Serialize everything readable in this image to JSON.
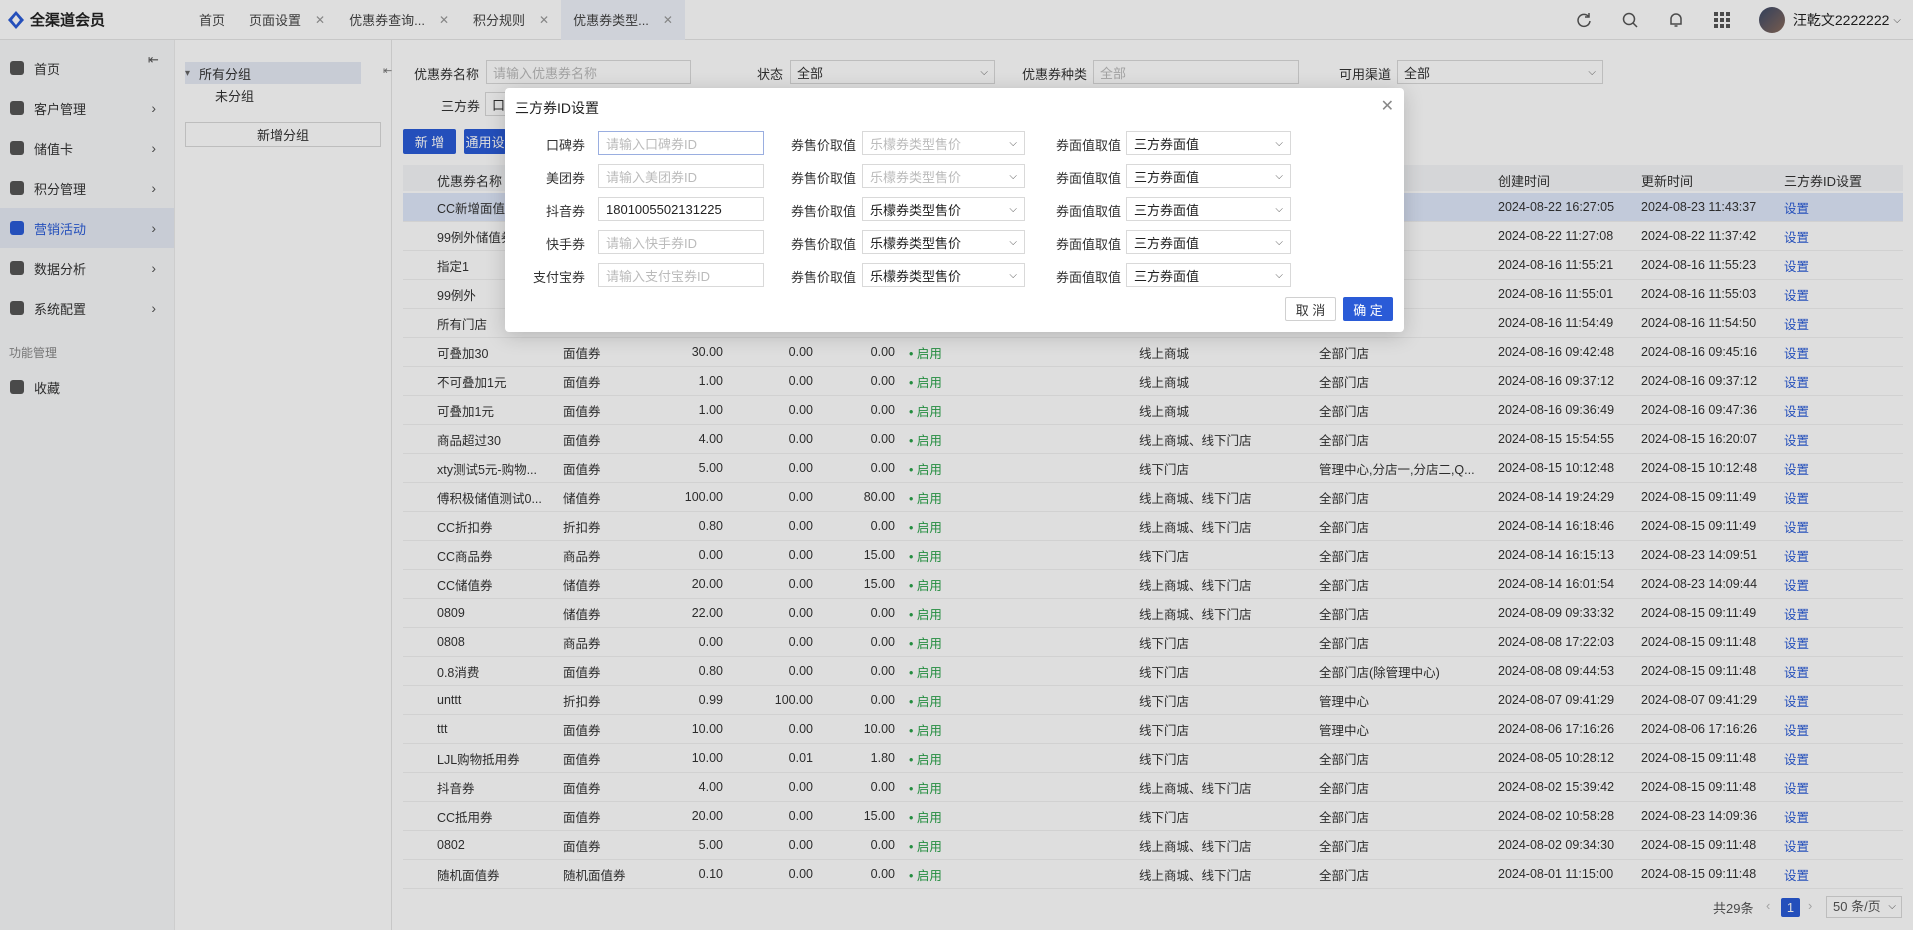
{
  "app": {
    "name": "全渠道会员",
    "username": "汪乾文2222222"
  },
  "tabs": [
    {
      "label": "首页",
      "closable": false
    },
    {
      "label": "页面设置",
      "closable": true
    },
    {
      "label": "优惠券查询...",
      "closable": true
    },
    {
      "label": "积分规则",
      "closable": true
    },
    {
      "label": "优惠券类型...",
      "closable": true,
      "active": true
    }
  ],
  "sidebar": {
    "items": [
      {
        "label": "首页",
        "icon": "home-icon"
      },
      {
        "label": "客户管理",
        "icon": "user-icon"
      },
      {
        "label": "储值卡",
        "icon": "card-icon"
      },
      {
        "label": "积分管理",
        "icon": "points-icon"
      },
      {
        "label": "营销活动",
        "icon": "marketing-icon",
        "active": true
      },
      {
        "label": "数据分析",
        "icon": "chart-icon"
      },
      {
        "label": "系统配置",
        "icon": "settings-icon"
      }
    ],
    "section_title": "功能管理",
    "favorites_label": "收藏"
  },
  "groups": {
    "root": "所有分组",
    "child": "未分组",
    "new_button": "新增分组"
  },
  "filters": {
    "name_label": "优惠券名称",
    "name_placeholder": "请输入优惠券名称",
    "status_label": "状态",
    "status_value": "全部",
    "type_label": "优惠券种类",
    "type_placeholder": "全部",
    "channel_label": "可用渠道",
    "channel_value": "全部",
    "third_label": "三方券",
    "third_value": "口",
    "add_button": "新 增",
    "general_button": "通用设"
  },
  "table": {
    "headers": {
      "name": "优惠券名称",
      "created": "创建时间",
      "updated": "更新时间",
      "third": "三方券ID设置"
    },
    "rows": [
      {
        "name": "CC新增面值",
        "type": "",
        "v1": "",
        "v2": "",
        "v3": "",
        "status": "",
        "channel": "",
        "store": "",
        "created": "2024-08-22 16:27:05",
        "updated": "2024-08-23 11:43:37",
        "action": "设置"
      },
      {
        "name": "99例外储值券",
        "type": "",
        "v1": "",
        "v2": "",
        "v3": "",
        "status": "",
        "channel": "",
        "store": "",
        "created": "2024-08-22 11:27:08",
        "updated": "2024-08-22 11:37:42",
        "action": "设置"
      },
      {
        "name": "指定1",
        "type": "",
        "v1": "",
        "v2": "",
        "v3": "",
        "status": "",
        "channel": "",
        "store": "",
        "created": "2024-08-16 11:55:21",
        "updated": "2024-08-16 11:55:23",
        "action": "设置"
      },
      {
        "name": "99例外",
        "type": "",
        "v1": "",
        "v2": "",
        "v3": "",
        "status": "",
        "channel": "",
        "store": "理中心)",
        "created": "2024-08-16 11:55:01",
        "updated": "2024-08-16 11:55:03",
        "action": "设置"
      },
      {
        "name": "所有门店",
        "type": "",
        "v1": "",
        "v2": "",
        "v3": "",
        "status": "",
        "channel": "",
        "store": "",
        "created": "2024-08-16 11:54:49",
        "updated": "2024-08-16 11:54:50",
        "action": "设置"
      },
      {
        "name": "可叠加30",
        "type": "面值券",
        "v1": "30.00",
        "v2": "0.00",
        "v3": "0.00",
        "status": "• 启用",
        "channel": "线上商城",
        "store": "全部门店",
        "created": "2024-08-16 09:42:48",
        "updated": "2024-08-16 09:45:16",
        "action": "设置"
      },
      {
        "name": "不可叠加1元",
        "type": "面值券",
        "v1": "1.00",
        "v2": "0.00",
        "v3": "0.00",
        "status": "• 启用",
        "channel": "线上商城",
        "store": "全部门店",
        "created": "2024-08-16 09:37:12",
        "updated": "2024-08-16 09:37:12",
        "action": "设置"
      },
      {
        "name": "可叠加1元",
        "type": "面值券",
        "v1": "1.00",
        "v2": "0.00",
        "v3": "0.00",
        "status": "• 启用",
        "channel": "线上商城",
        "store": "全部门店",
        "created": "2024-08-16 09:36:49",
        "updated": "2024-08-16 09:47:36",
        "action": "设置"
      },
      {
        "name": "商品超过30",
        "type": "面值券",
        "v1": "4.00",
        "v2": "0.00",
        "v3": "0.00",
        "status": "• 启用",
        "channel": "线上商城、线下门店",
        "store": "全部门店",
        "created": "2024-08-15 15:54:55",
        "updated": "2024-08-15 16:20:07",
        "action": "设置"
      },
      {
        "name": "xty测试5元-购物...",
        "type": "面值券",
        "v1": "5.00",
        "v2": "0.00",
        "v3": "0.00",
        "status": "• 启用",
        "channel": "线下门店",
        "store": "管理中心,分店一,分店二,Q...",
        "created": "2024-08-15 10:12:48",
        "updated": "2024-08-15 10:12:48",
        "action": "设置"
      },
      {
        "name": "傅积极储值测试0...",
        "type": "储值券",
        "v1": "100.00",
        "v2": "0.00",
        "v3": "80.00",
        "status": "• 启用",
        "channel": "线上商城、线下门店",
        "store": "全部门店",
        "created": "2024-08-14 19:24:29",
        "updated": "2024-08-15 09:11:49",
        "action": "设置"
      },
      {
        "name": "CC折扣券",
        "type": "折扣券",
        "v1": "0.80",
        "v2": "0.00",
        "v3": "0.00",
        "status": "• 启用",
        "channel": "线上商城、线下门店",
        "store": "全部门店",
        "created": "2024-08-14 16:18:46",
        "updated": "2024-08-15 09:11:49",
        "action": "设置"
      },
      {
        "name": "CC商品券",
        "type": "商品券",
        "v1": "0.00",
        "v2": "0.00",
        "v3": "15.00",
        "status": "• 启用",
        "channel": "线下门店",
        "store": "全部门店",
        "created": "2024-08-14 16:15:13",
        "updated": "2024-08-23 14:09:51",
        "action": "设置"
      },
      {
        "name": "CC储值券",
        "type": "储值券",
        "v1": "20.00",
        "v2": "0.00",
        "v3": "15.00",
        "status": "• 启用",
        "channel": "线上商城、线下门店",
        "store": "全部门店",
        "created": "2024-08-14 16:01:54",
        "updated": "2024-08-23 14:09:44",
        "action": "设置"
      },
      {
        "name": "0809",
        "type": "储值券",
        "v1": "22.00",
        "v2": "0.00",
        "v3": "0.00",
        "status": "• 启用",
        "channel": "线上商城、线下门店",
        "store": "全部门店",
        "created": "2024-08-09 09:33:32",
        "updated": "2024-08-15 09:11:49",
        "action": "设置"
      },
      {
        "name": "0808",
        "type": "商品券",
        "v1": "0.00",
        "v2": "0.00",
        "v3": "0.00",
        "status": "• 启用",
        "channel": "线下门店",
        "store": "全部门店",
        "created": "2024-08-08 17:22:03",
        "updated": "2024-08-15 09:11:48",
        "action": "设置"
      },
      {
        "name": "0.8消费",
        "type": "面值券",
        "v1": "0.80",
        "v2": "0.00",
        "v3": "0.00",
        "status": "• 启用",
        "channel": "线下门店",
        "store": "全部门店(除管理中心)",
        "created": "2024-08-08 09:44:53",
        "updated": "2024-08-15 09:11:48",
        "action": "设置"
      },
      {
        "name": "unttt",
        "type": "折扣券",
        "v1": "0.99",
        "v2": "100.00",
        "v3": "0.00",
        "status": "• 启用",
        "channel": "线下门店",
        "store": "管理中心",
        "created": "2024-08-07 09:41:29",
        "updated": "2024-08-07 09:41:29",
        "action": "设置"
      },
      {
        "name": "ttt",
        "type": "面值券",
        "v1": "10.00",
        "v2": "0.00",
        "v3": "10.00",
        "status": "• 启用",
        "channel": "线下门店",
        "store": "管理中心",
        "created": "2024-08-06 17:16:26",
        "updated": "2024-08-06 17:16:26",
        "action": "设置"
      },
      {
        "name": "LJL购物抵用券",
        "type": "面值券",
        "v1": "10.00",
        "v2": "0.01",
        "v3": "1.80",
        "status": "• 启用",
        "channel": "线下门店",
        "store": "全部门店",
        "created": "2024-08-05 10:28:12",
        "updated": "2024-08-15 09:11:48",
        "action": "设置"
      },
      {
        "name": "抖音券",
        "type": "面值券",
        "v1": "4.00",
        "v2": "0.00",
        "v3": "0.00",
        "status": "• 启用",
        "channel": "线上商城、线下门店",
        "store": "全部门店",
        "created": "2024-08-02 15:39:42",
        "updated": "2024-08-15 09:11:48",
        "action": "设置"
      },
      {
        "name": "CC抵用券",
        "type": "面值券",
        "v1": "20.00",
        "v2": "0.00",
        "v3": "15.00",
        "status": "• 启用",
        "channel": "线下门店",
        "store": "全部门店",
        "created": "2024-08-02 10:58:28",
        "updated": "2024-08-23 14:09:36",
        "action": "设置"
      },
      {
        "name": "0802",
        "type": "面值券",
        "v1": "5.00",
        "v2": "0.00",
        "v3": "0.00",
        "status": "• 启用",
        "channel": "线上商城、线下门店",
        "store": "全部门店",
        "created": "2024-08-02 09:34:30",
        "updated": "2024-08-15 09:11:48",
        "action": "设置"
      },
      {
        "name": "随机面值券",
        "type": "随机面值券",
        "v1": "0.10",
        "v2": "0.00",
        "v3": "0.00",
        "status": "• 启用",
        "channel": "线上商城、线下门店",
        "store": "全部门店",
        "created": "2024-08-01 11:15:00",
        "updated": "2024-08-15 09:11:48",
        "action": "设置"
      }
    ]
  },
  "pager": {
    "total": "共29条",
    "page": "1",
    "page_size": "50 条/页"
  },
  "modal": {
    "title": "三方券ID设置",
    "price_label": "券售价取值",
    "face_label": "券面值取值",
    "rows": [
      {
        "label": "口碑券",
        "value": "",
        "placeholder": "请输入口碑券ID",
        "price": "乐檬券类型售价",
        "price_disabled": true,
        "face": "三方券面值"
      },
      {
        "label": "美团券",
        "value": "",
        "placeholder": "请输入美团券ID",
        "price": "乐檬券类型售价",
        "price_disabled": true,
        "face": "三方券面值"
      },
      {
        "label": "抖音券",
        "value": "1801005502131225",
        "placeholder": "",
        "price": "乐檬券类型售价",
        "price_disabled": false,
        "face": "三方券面值"
      },
      {
        "label": "快手券",
        "value": "",
        "placeholder": "请输入快手券ID",
        "price": "乐檬券类型售价",
        "price_disabled": false,
        "face": "三方券面值"
      },
      {
        "label": "支付宝券",
        "value": "",
        "placeholder": "请输入支付宝券ID",
        "price": "乐檬券类型售价",
        "price_disabled": false,
        "face": "三方券面值"
      }
    ],
    "cancel": "取 消",
    "confirm": "确 定"
  },
  "colors": {
    "primary": "#2a5bd7",
    "enabled": "#2aa34a"
  }
}
